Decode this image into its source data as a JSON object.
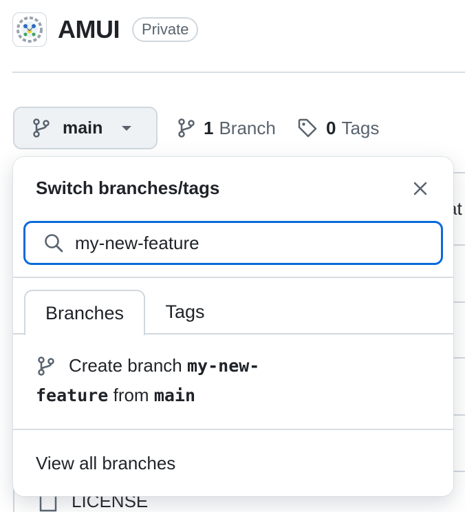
{
  "repo": {
    "name": "AMUI",
    "visibility": "Private"
  },
  "branch_bar": {
    "current_branch": "main",
    "branches_count": "1",
    "branches_label": "Branch",
    "tags_count": "0",
    "tags_label": "Tags"
  },
  "dropdown": {
    "title": "Switch branches/tags",
    "search_value": "my-new-feature",
    "tabs": [
      {
        "label": "Branches",
        "active": true
      },
      {
        "label": "Tags",
        "active": false
      }
    ],
    "create_prefix": "Create branch",
    "create_name_part1": "my-new-",
    "create_name_part2": "feature",
    "create_from": "from",
    "create_base": "main",
    "view_all": "View all branches"
  },
  "background": {
    "partial_text": "at",
    "file_name": "LICENSE"
  },
  "colors": {
    "accent_blue": "#0969da",
    "border": "#d0d7de",
    "muted_text": "#59636e",
    "text": "#1f2328"
  },
  "icons": {
    "branch": "git-branch-icon",
    "tag": "tag-icon",
    "search": "search-icon",
    "close": "close-icon",
    "file": "file-icon"
  }
}
